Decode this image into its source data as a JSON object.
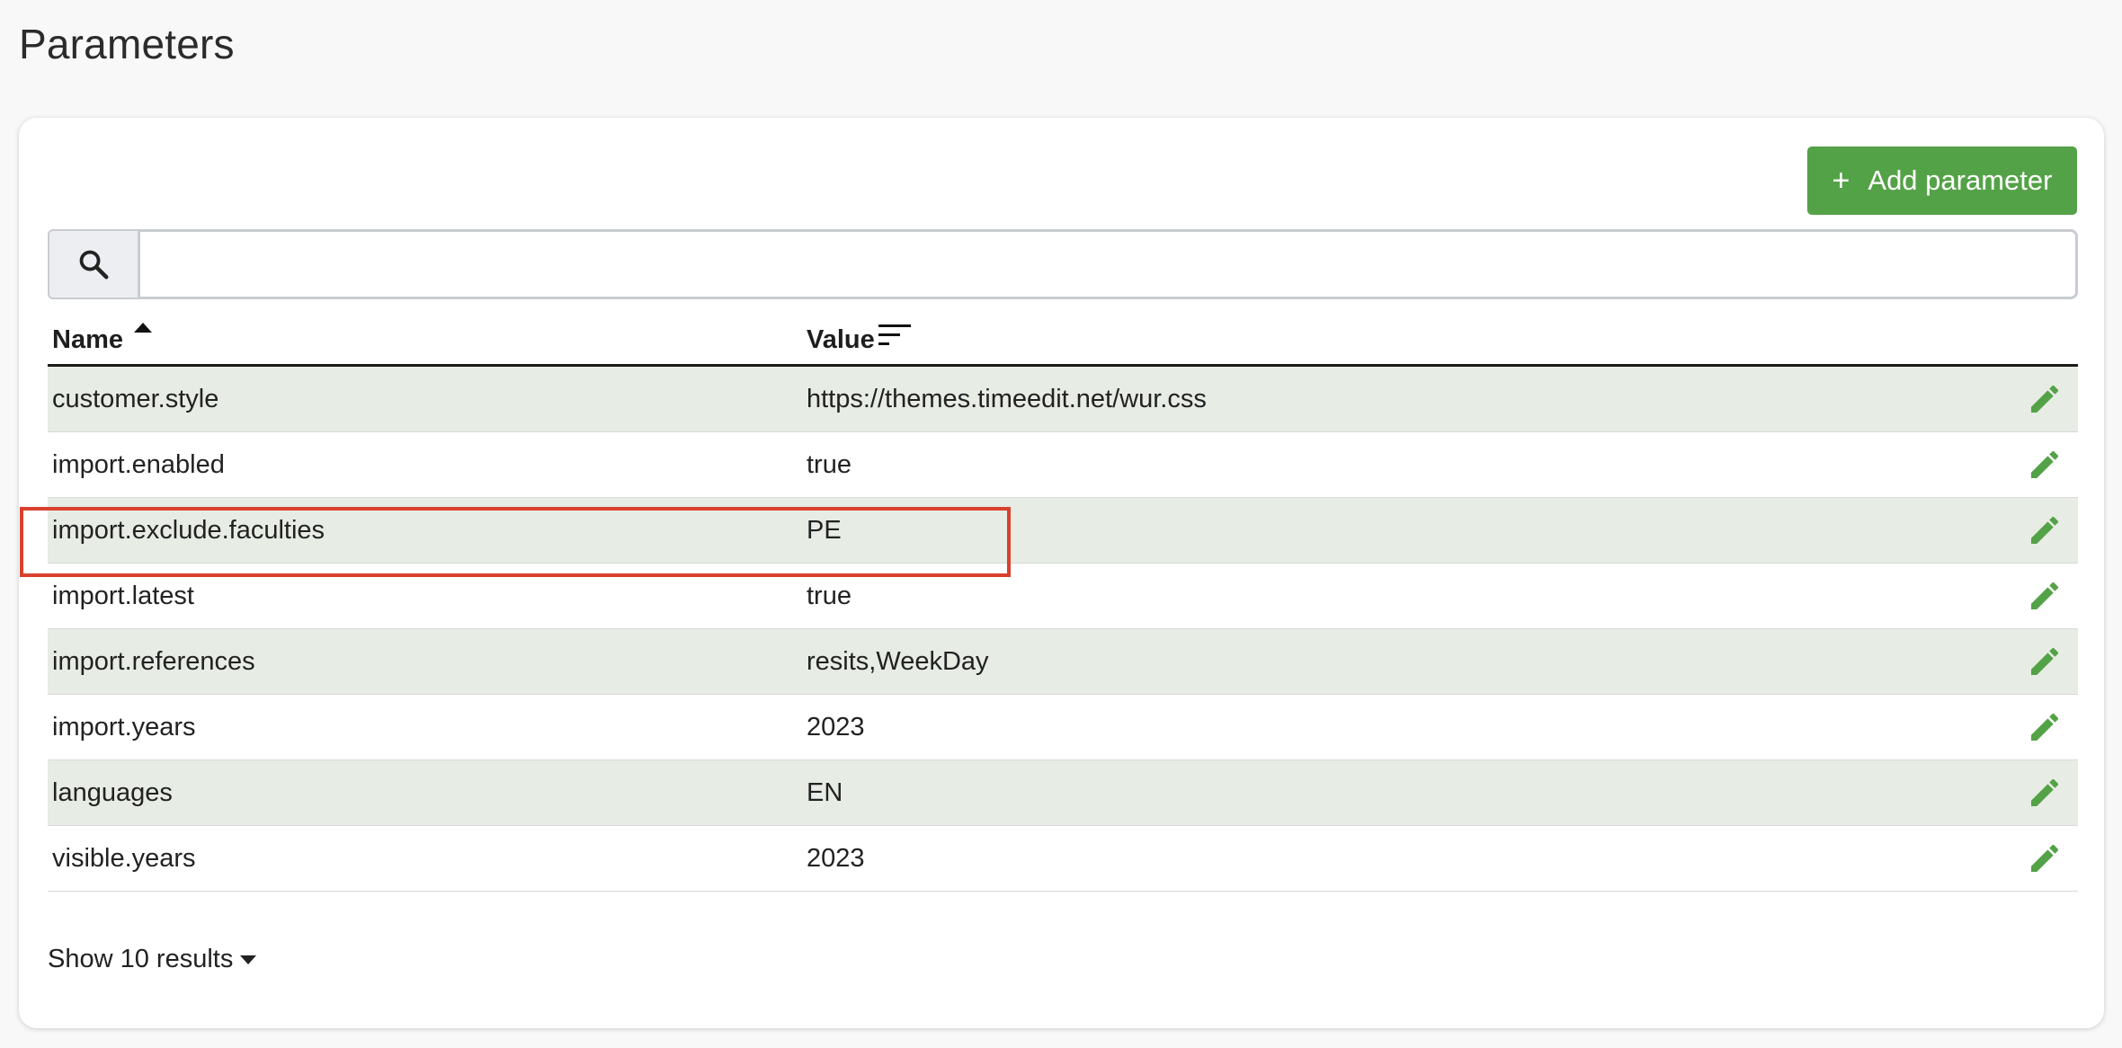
{
  "page": {
    "title": "Parameters"
  },
  "toolbar": {
    "add_label": "Add parameter",
    "add_icon": "plus-icon"
  },
  "search": {
    "value": "",
    "placeholder": "",
    "icon": "search-icon"
  },
  "table": {
    "columns": {
      "name": "Name",
      "value": "Value"
    },
    "sort": {
      "column": "Name",
      "direction": "ascending"
    },
    "rows": [
      {
        "name": "customer.style",
        "value": "https://themes.timeedit.net/wur.css"
      },
      {
        "name": "import.enabled",
        "value": "true"
      },
      {
        "name": "import.exclude.faculties",
        "value": "PE"
      },
      {
        "name": "import.latest",
        "value": "true"
      },
      {
        "name": "import.references",
        "value": "resits,WeekDay"
      },
      {
        "name": "import.years",
        "value": "2023"
      },
      {
        "name": "languages",
        "value": "EN"
      },
      {
        "name": "visible.years",
        "value": "2023"
      }
    ],
    "highlighted_row": "import.references"
  },
  "pagination": {
    "page_size_label": "Show 10 results"
  },
  "colors": {
    "accent": "#54a247",
    "row_stripe": "#e7ece4",
    "highlight": "#d9402e"
  }
}
